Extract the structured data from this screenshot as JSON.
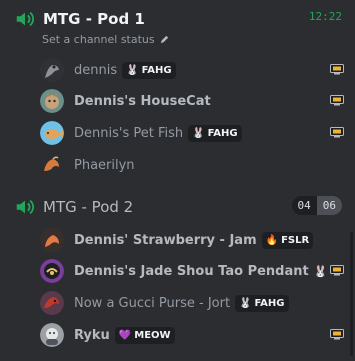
{
  "colors": {
    "background": "#2b2d31",
    "voice_icon": "#23a55a",
    "timer": "#23a55a",
    "stream_icon": "#f0b232"
  },
  "channel1": {
    "title": "MTG - Pod 1",
    "timer": "12:22",
    "status_text": "Set a channel status",
    "members": [
      {
        "name": "dennis",
        "tag": "FAHG",
        "tag_icon": "bunny-icon"
      },
      {
        "name": "Dennis's HouseCat",
        "tag": ""
      },
      {
        "name": "Dennis's Pet Fish",
        "tag": "FAHG",
        "tag_icon": "bunny-icon"
      },
      {
        "name": "Phaerilyn",
        "tag": ""
      }
    ]
  },
  "channel2": {
    "title": "MTG - Pod 2",
    "count_current": "04",
    "count_max": "06",
    "members": [
      {
        "name": "Dennis' Strawberry - Jam",
        "tag": "FSLR",
        "tag_icon": "fire-icon"
      },
      {
        "name": "Dennis's Jade Shou Tao Pendant",
        "tag": ""
      },
      {
        "name": "Now a Gucci Purse - Jort",
        "tag": "FAHG",
        "tag_icon": "bunny-icon"
      },
      {
        "name": "Ryku",
        "tag": "MEOW",
        "tag_icon": "heart-icon"
      }
    ]
  }
}
